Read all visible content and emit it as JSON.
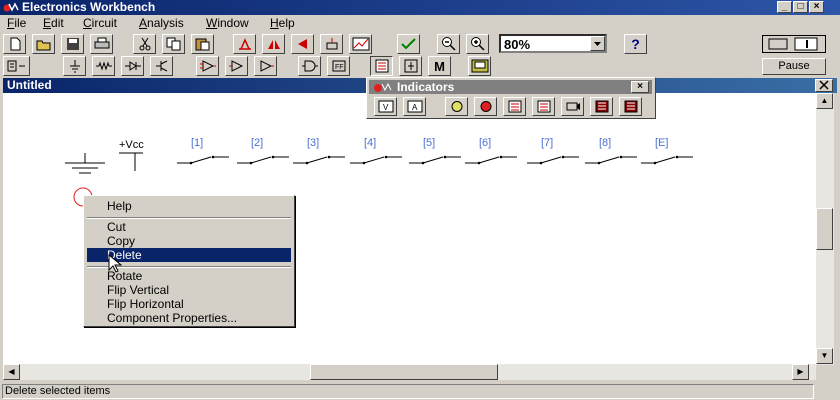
{
  "window": {
    "title": "Electronics Workbench"
  },
  "caption_buttons": [
    "_",
    "□",
    "×"
  ],
  "menu": [
    {
      "label": "File",
      "u": "F"
    },
    {
      "label": "Edit",
      "u": "E"
    },
    {
      "label": "Circuit",
      "u": "C"
    },
    {
      "label": "Analysis",
      "u": "A"
    },
    {
      "label": "Window",
      "u": "W"
    },
    {
      "label": "Help",
      "u": "H"
    }
  ],
  "toolbar": {
    "zoom_value": "80%",
    "help_icon": "?",
    "pause_label": "Pause"
  },
  "parts_bin": {
    "label_m": "M"
  },
  "document": {
    "title": "Untitled"
  },
  "indicators_panel": {
    "title": "Indicators",
    "close": "×"
  },
  "circuit": {
    "vcc_label": "+Vcc",
    "switch_labels": [
      "[1]",
      "[2]",
      "[3]",
      "[4]",
      "[5]",
      "[6]",
      "[7]",
      "[8]",
      "[E]"
    ]
  },
  "context_menu": {
    "items": [
      "Help",
      "Cut",
      "Copy",
      "Delete",
      "Rotate",
      "Flip Vertical",
      "Flip Horizontal",
      "Component Properties..."
    ],
    "selected": "Delete"
  },
  "status": {
    "text": "Delete selected items"
  },
  "colors": {
    "title_bar": "#0a246a",
    "selection": "#0a246a",
    "switch_label": "#4b6fd6"
  }
}
